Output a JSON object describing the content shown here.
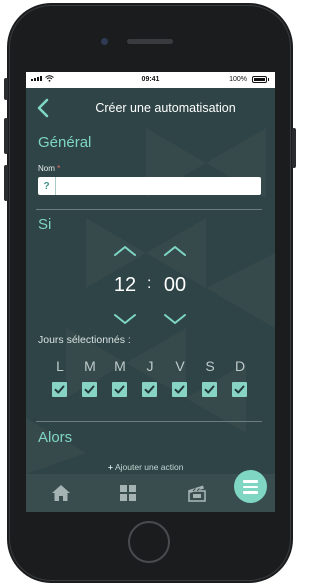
{
  "status_bar": {
    "time": "09:41",
    "battery": "100%"
  },
  "header": {
    "title": "Créer une automatisation"
  },
  "general": {
    "section_title": "Général",
    "name_label": "Nom",
    "name_required_mark": "*",
    "name_prefix": "?",
    "name_value": ""
  },
  "si": {
    "section_title": "Si",
    "hours": "12",
    "separator": ":",
    "minutes": "00",
    "days_label": "Jours sélectionnés :",
    "days": [
      {
        "letter": "L",
        "checked": true
      },
      {
        "letter": "M",
        "checked": true
      },
      {
        "letter": "M",
        "checked": true
      },
      {
        "letter": "J",
        "checked": true
      },
      {
        "letter": "V",
        "checked": true
      },
      {
        "letter": "S",
        "checked": true
      },
      {
        "letter": "D",
        "checked": true
      }
    ]
  },
  "alors": {
    "section_title": "Alors",
    "add_action_plus": "+",
    "add_action_label": "Ajouter une action"
  },
  "nav": {
    "items": [
      {
        "icon": "home-icon"
      },
      {
        "icon": "grid-icon"
      },
      {
        "icon": "clapperboard-icon"
      }
    ],
    "fab_icon": "menu-icon"
  },
  "colors": {
    "accent": "#7fd6c3",
    "background": "#2f4446",
    "nav": "#394d4f"
  }
}
